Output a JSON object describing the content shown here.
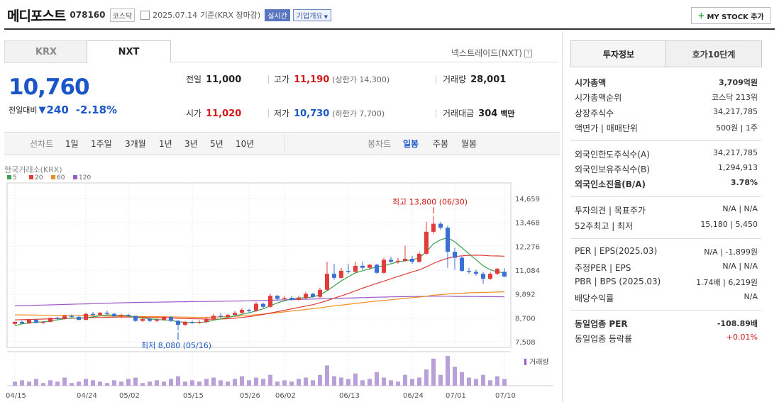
{
  "header": {
    "company": "메디포스트",
    "code": "078160",
    "market": "코스닥",
    "date": "2025.07.14",
    "basis": "기준(KRX 장마감)",
    "realtime": "실시간",
    "overview": "기업개요",
    "my_stock": "MY STOCK 추가"
  },
  "tabs": {
    "krx": "KRX",
    "nxt": "NXT"
  },
  "nxt_label": "넥스트레이드(NXT)",
  "quote": {
    "price": "10,760",
    "change_label": "전일대비",
    "change": "240",
    "change_pct": "-2.18%",
    "prev_label": "전일",
    "prev": "11,000",
    "high_label": "고가",
    "high": "11,190",
    "upper_limit": "(상한가 14,300)",
    "volume_label": "거래량",
    "volume": "28,001",
    "open_label": "시가",
    "open": "11,020",
    "low_label": "저가",
    "low": "10,730",
    "lower_limit": "(하한가 7,700)",
    "amount_label": "거래대금",
    "amount": "304",
    "amount_unit": "백만"
  },
  "period": {
    "line_label": "선차트",
    "line_items": [
      "1일",
      "1주일",
      "3개월",
      "1년",
      "3년",
      "5년",
      "10년"
    ],
    "candle_label": "봉차트",
    "candle_items": [
      "일봉",
      "주봉",
      "월봉"
    ],
    "candle_selected": "일봉"
  },
  "chart_data": {
    "type": "candlestick",
    "title": "한국거래소(KRX)",
    "legend": [
      "5",
      "20",
      "60",
      "120"
    ],
    "legend_colors": [
      "#3aa04c",
      "#e03c3c",
      "#f08c1e",
      "#9b59c8"
    ],
    "y_ticks": [
      14659,
      13468,
      12276,
      11084,
      9892,
      8700,
      7508
    ],
    "ylim": [
      7508,
      14659
    ],
    "x_ticks": [
      "04/15",
      "04/24",
      "05/02",
      "05/15",
      "05/26",
      "06/02",
      "06/13",
      "06/24",
      "07/01",
      "07/10"
    ],
    "high_note": "최고 13,800 (06/30)",
    "low_note": "최저 8,080 (05/16)",
    "volume_label": "거래량",
    "candles": [
      [
        8400,
        8500,
        8350,
        8520
      ],
      [
        8500,
        8420,
        8380,
        8560
      ],
      [
        8420,
        8600,
        8400,
        8620
      ],
      [
        8600,
        8450,
        8420,
        8650
      ],
      [
        8450,
        8500,
        8400,
        8560
      ],
      [
        8500,
        8700,
        8480,
        8720
      ],
      [
        8700,
        8650,
        8600,
        8760
      ],
      [
        8650,
        8800,
        8620,
        8850
      ],
      [
        8800,
        8750,
        8700,
        8880
      ],
      [
        8750,
        8600,
        8580,
        8800
      ],
      [
        8600,
        8900,
        8580,
        8950
      ],
      [
        8900,
        8850,
        8800,
        9000
      ],
      [
        8850,
        8950,
        8800,
        9000
      ],
      [
        8950,
        8900,
        8850,
        9050
      ],
      [
        8900,
        8780,
        8740,
        8960
      ],
      [
        8780,
        8850,
        8700,
        8900
      ],
      [
        8850,
        8800,
        8750,
        8900
      ],
      [
        8800,
        8550,
        8500,
        8820
      ],
      [
        8550,
        8650,
        8500,
        8700
      ],
      [
        8650,
        8550,
        8500,
        8700
      ],
      [
        8550,
        8600,
        8480,
        8680
      ],
      [
        8600,
        8750,
        8550,
        8800
      ],
      [
        8750,
        8550,
        8500,
        8780
      ],
      [
        8550,
        8350,
        8080,
        8600
      ],
      [
        8350,
        8500,
        8300,
        8550
      ],
      [
        8500,
        8450,
        8400,
        8560
      ],
      [
        8450,
        8500,
        8400,
        8600
      ],
      [
        8500,
        8650,
        8450,
        8750
      ],
      [
        8650,
        8800,
        8600,
        8900
      ],
      [
        8800,
        8750,
        8700,
        8950
      ],
      [
        8750,
        8850,
        8700,
        8900
      ],
      [
        8850,
        8950,
        8800,
        9050
      ],
      [
        8950,
        9100,
        8900,
        9200
      ],
      [
        9100,
        9050,
        8950,
        9150
      ],
      [
        9050,
        9400,
        9000,
        9500
      ],
      [
        9400,
        9250,
        9200,
        9450
      ],
      [
        9250,
        9800,
        9200,
        9900
      ],
      [
        9800,
        9650,
        9550,
        9850
      ],
      [
        9650,
        9700,
        9600,
        9800
      ],
      [
        9700,
        9600,
        9550,
        9800
      ],
      [
        9600,
        9700,
        9550,
        9800
      ],
      [
        9700,
        9900,
        9650,
        10000
      ],
      [
        9900,
        9750,
        9700,
        9950
      ],
      [
        9750,
        10100,
        9700,
        10200
      ],
      [
        10100,
        10900,
        10050,
        11500
      ],
      [
        10900,
        10700,
        10600,
        11400
      ],
      [
        10700,
        11050,
        10650,
        11200
      ],
      [
        11050,
        11000,
        10900,
        11400
      ],
      [
        11000,
        11300,
        10950,
        11500
      ],
      [
        11300,
        11200,
        11100,
        11500
      ],
      [
        11200,
        11350,
        11100,
        11400
      ],
      [
        11350,
        10950,
        10900,
        11400
      ],
      [
        10950,
        11600,
        10900,
        11700
      ],
      [
        11600,
        11500,
        11450,
        11750
      ],
      [
        11500,
        11550,
        11400,
        11700
      ],
      [
        11550,
        11650,
        11500,
        12300
      ],
      [
        11650,
        11500,
        11400,
        11800
      ],
      [
        11500,
        11900,
        11450,
        12000
      ],
      [
        11900,
        13000,
        11850,
        13500
      ],
      [
        13000,
        13400,
        12900,
        13800
      ],
      [
        13400,
        13200,
        13100,
        13500
      ],
      [
        13200,
        12000,
        11200,
        13300
      ],
      [
        12000,
        11700,
        11100,
        12200
      ],
      [
        11700,
        11050,
        11000,
        11800
      ],
      [
        11050,
        11000,
        10900,
        11200
      ],
      [
        11000,
        10900,
        10800,
        11100
      ],
      [
        10900,
        10650,
        10400,
        11000
      ],
      [
        10650,
        10900,
        10600,
        11000
      ],
      [
        10900,
        11150,
        10850,
        11200
      ],
      [
        11000,
        10760,
        10730,
        11190
      ]
    ],
    "volumes": [
      3,
      4,
      3,
      5,
      2,
      4,
      3,
      6,
      2,
      3,
      5,
      4,
      3,
      2,
      4,
      3,
      5,
      6,
      2,
      3,
      4,
      3,
      5,
      7,
      3,
      4,
      3,
      5,
      6,
      4,
      3,
      5,
      7,
      4,
      6,
      5,
      8,
      3,
      4,
      3,
      5,
      6,
      4,
      8,
      15,
      7,
      6,
      5,
      9,
      4,
      5,
      10,
      6,
      4,
      3,
      8,
      5,
      6,
      12,
      20,
      8,
      22,
      14,
      10,
      6,
      5,
      8,
      4,
      7,
      5
    ],
    "ma5": [
      8300,
      8400,
      8450,
      8480,
      8500,
      8550,
      8600,
      8650,
      8700,
      8680,
      8700,
      8750,
      8800,
      8850,
      8830,
      8820,
      8800,
      8720,
      8700,
      8650,
      8620,
      8600,
      8580,
      8500,
      8480,
      8460,
      8470,
      8500,
      8580,
      8650,
      8720,
      8800,
      8880,
      8950,
      9050,
      9150,
      9300,
      9450,
      9550,
      9650,
      9700,
      9700,
      9750,
      9850,
      10050,
      10300,
      10550,
      10750,
      10950,
      11050,
      11150,
      11250,
      11300,
      11400,
      11500,
      11550,
      11600,
      11700,
      12000,
      12400,
      12600,
      12700,
      12500,
      12200,
      11900,
      11600,
      11300,
      11100,
      11000,
      10950
    ],
    "ma20": [
      8600,
      8610,
      8620,
      8630,
      8640,
      8650,
      8660,
      8670,
      8680,
      8690,
      8700,
      8710,
      8720,
      8730,
      8735,
      8740,
      8740,
      8735,
      8730,
      8720,
      8710,
      8700,
      8690,
      8680,
      8670,
      8660,
      8650,
      8640,
      8630,
      8640,
      8660,
      8680,
      8720,
      8760,
      8810,
      8870,
      8940,
      9010,
      9080,
      9150,
      9220,
      9290,
      9360,
      9450,
      9560,
      9680,
      9800,
      9920,
      10050,
      10180,
      10300,
      10420,
      10530,
      10650,
      10770,
      10880,
      10990,
      11100,
      11250,
      11420,
      11560,
      11680,
      11760,
      11800,
      11820,
      11830,
      11820,
      11800,
      11790,
      11780
    ],
    "ma60": [
      8850,
      8850,
      8840,
      8840,
      8830,
      8830,
      8820,
      8820,
      8810,
      8810,
      8800,
      8800,
      8800,
      8790,
      8790,
      8780,
      8780,
      8770,
      8770,
      8760,
      8760,
      8750,
      8750,
      8740,
      8740,
      8730,
      8730,
      8730,
      8740,
      8750,
      8760,
      8780,
      8800,
      8830,
      8860,
      8890,
      8920,
      8960,
      9000,
      9040,
      9080,
      9120,
      9160,
      9200,
      9250,
      9300,
      9340,
      9380,
      9420,
      9460,
      9500,
      9540,
      9570,
      9600,
      9640,
      9680,
      9710,
      9740,
      9780,
      9830,
      9860,
      9890,
      9910,
      9930,
      9950,
      9960,
      9970,
      9980,
      9990,
      10000
    ],
    "ma120": [
      9300,
      9310,
      9320,
      9330,
      9340,
      9350,
      9360,
      9370,
      9380,
      9390,
      9400,
      9410,
      9420,
      9430,
      9440,
      9450,
      9460,
      9470,
      9475,
      9480,
      9485,
      9490,
      9495,
      9500,
      9505,
      9510,
      9515,
      9520,
      9525,
      9530,
      9535,
      9540,
      9545,
      9550,
      9560,
      9570,
      9580,
      9590,
      9600,
      9610,
      9620,
      9630,
      9640,
      9650,
      9660,
      9670,
      9680,
      9690,
      9700,
      9710,
      9720,
      9730,
      9740,
      9750,
      9755,
      9760,
      9765,
      9770,
      9775,
      9780,
      9780,
      9780,
      9775,
      9770,
      9770,
      9765,
      9760,
      9760,
      9755,
      9750
    ]
  },
  "right": {
    "tab1": "투자정보",
    "tab2": "호가10단계",
    "rows": [
      {
        "k": "시가총액",
        "v": "3,709억원",
        "bold": true
      },
      {
        "k": "시가총액순위",
        "v": "코스닥 213위"
      },
      {
        "k": "상장주식수",
        "v": "34,217,785"
      },
      {
        "k": "액면가 | 매매단위",
        "v": "500원 | 1주"
      },
      {
        "k": "외국인한도주식수(A)",
        "v": "34,217,785"
      },
      {
        "k": "외국인보유주식수(B)",
        "v": "1,294,913"
      },
      {
        "k": "외국인소진율(B/A)",
        "v": "3.78%",
        "bold": true
      },
      {
        "k": "투자의견 | 목표주가",
        "v": "N/A | N/A"
      },
      {
        "k": "52주최고 | 최저",
        "v": "15,180 | 5,450"
      },
      {
        "k": "PER | EPS(2025.03)",
        "v": "N/A | -1,899원"
      },
      {
        "k": "추정PER | EPS",
        "v": "N/A | N/A"
      },
      {
        "k": "PBR | BPS (2025.03)",
        "v": "1.74배 | 6,219원"
      },
      {
        "k": "배당수익률",
        "v": "N/A"
      },
      {
        "k": "동일업종 PER",
        "v": "-108.89배",
        "bold": true
      },
      {
        "k": "동일업종 등락률",
        "v": "+0.01%",
        "red": true
      }
    ]
  }
}
